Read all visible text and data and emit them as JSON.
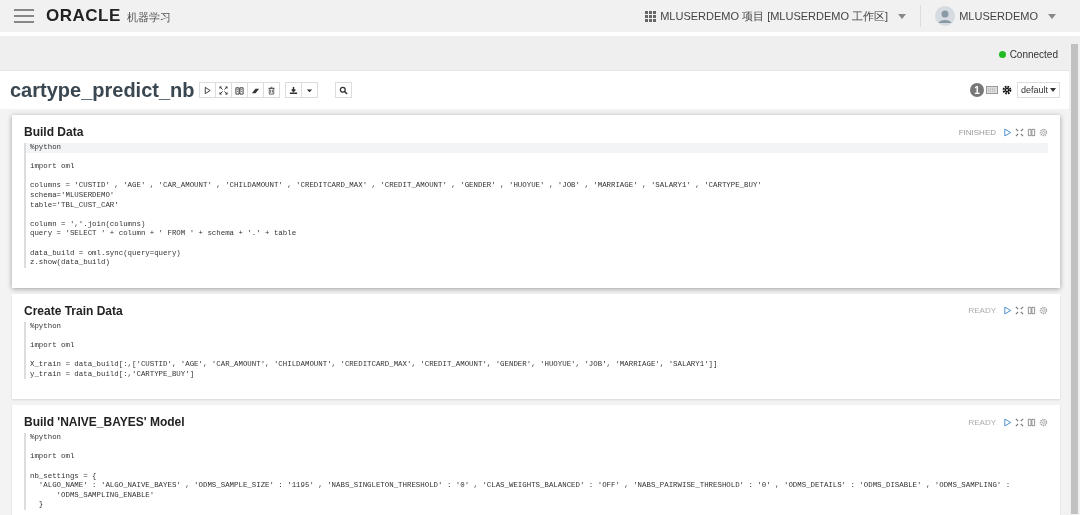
{
  "header": {
    "logo": "ORACLE",
    "app_name": "机器学习",
    "project": "MLUSERDEMO 项目 [MLUSERDEMO 工作区]",
    "user": "MLUSERDEMO"
  },
  "connection": {
    "label": "Connected",
    "color": "#22bb22"
  },
  "notebook": {
    "title": "cartype_predict_nb",
    "badge": "1",
    "interpreter": "default"
  },
  "paragraphs": [
    {
      "title": "Build Data",
      "status": "FINISHED",
      "selected": true,
      "code": [
        [
          "%python"
        ],
        [
          "import oml"
        ],
        [
          "columns = 'CUSTID' , 'AGE' , 'CAR_AMOUNT' , 'CHILDAMOUNT' , 'CREDITCARD_MAX' , 'CREDIT_AMOUNT' , 'GENDER' , 'HUOYUE' , 'JOB' , 'MARRIAGE' , 'SALARY1' , 'CARTYPE_BUY'",
          "schema='MLUSERDEMO'",
          "table='TBL_CUST_CAR'"
        ],
        [
          "column = ','.join(columns)",
          "query = 'SELECT ' + column + ' FROM ' + schema + '.' + table"
        ],
        [
          "data_build = oml.sync(query=query)",
          "z.show(data_build)"
        ]
      ]
    },
    {
      "title": "Create Train Data",
      "status": "READY",
      "selected": false,
      "code": [
        [
          "%python"
        ],
        [
          "import oml"
        ],
        [
          "X_train = data_build[:,['CUSTID', 'AGE', 'CAR_AMOUNT', 'CHILDAMOUNT', 'CREDITCARD_MAX', 'CREDIT_AMOUNT', 'GENDER', 'HUOYUE', 'JOB', 'MARRIAGE', 'SALARY1']]",
          "y_train = data_build[:,'CARTYPE_BUY']"
        ]
      ]
    },
    {
      "title": "Build 'NAIVE_BAYES' Model",
      "status": "READY",
      "selected": false,
      "code": [
        [
          "%python"
        ],
        [
          "import oml"
        ],
        [
          "nb_settings = {",
          "  'ALGO_NAME' : 'ALGO_NAIVE_BAYES' , 'ODMS_SAMPLE_SIZE' : '1195' , 'NABS_SINGLETON_THRESHOLD' : '0' , 'CLAS_WEIGHTS_BALANCED' : 'OFF' , 'NABS_PAIRWISE_THRESHOLD' : '0' , 'ODMS_DETAILS' : 'ODMS_DISABLE' , 'ODMS_SAMPLING' :",
          "      'ODMS_SAMPLING_ENABLE'",
          "  }"
        ]
      ]
    }
  ]
}
